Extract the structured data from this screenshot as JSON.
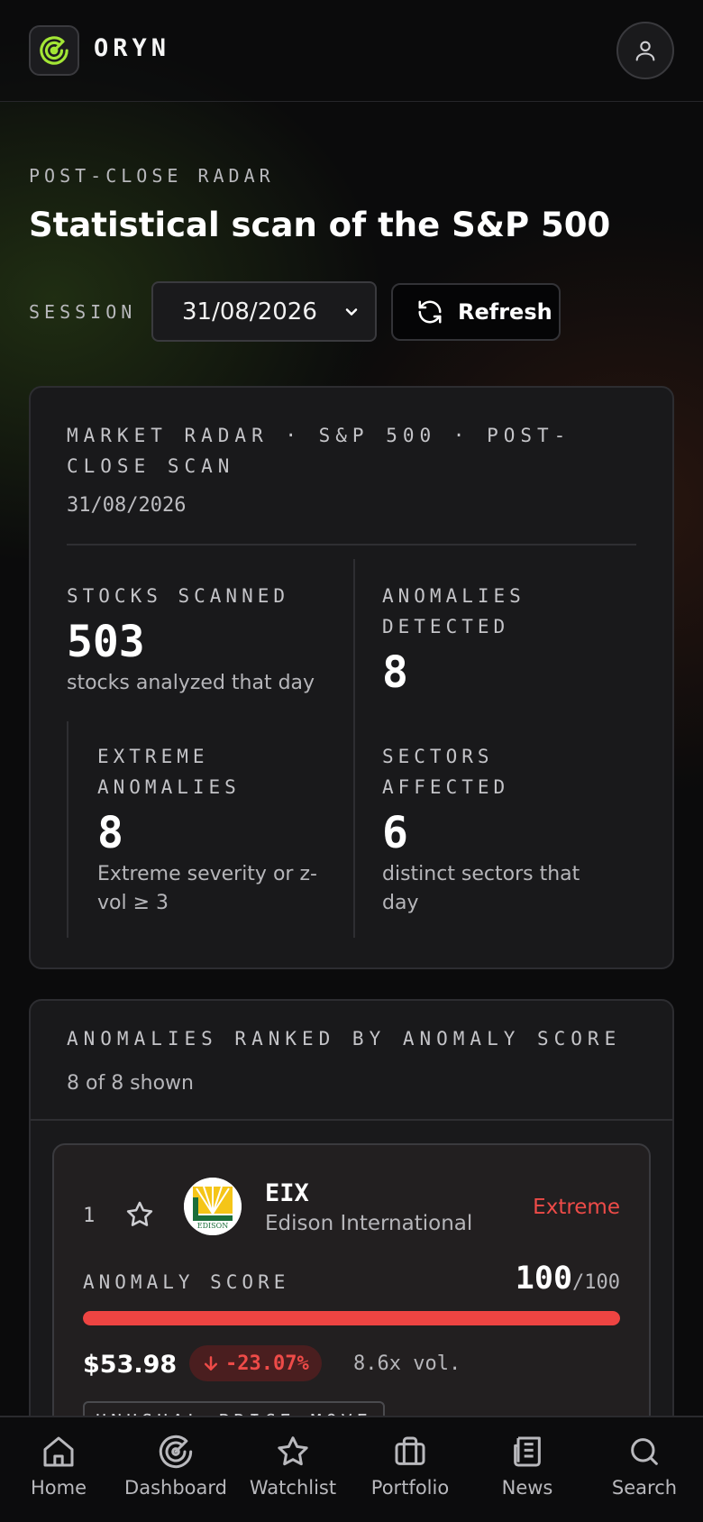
{
  "app": {
    "brand": "ORYN"
  },
  "hero": {
    "eyebrow": "POST-CLOSE RADAR",
    "title": "Statistical scan of the S&P 500",
    "session_label": "SESSION",
    "session_value": "31/08/2026",
    "refresh_label": "Refresh"
  },
  "summary": {
    "heading": "MARKET RADAR · S&P 500 · POST-CLOSE SCAN",
    "date": "31/08/2026",
    "stats": [
      {
        "label": "STOCKS SCANNED",
        "value": "503",
        "desc": "stocks analyzed that day"
      },
      {
        "label": "ANOMALIES DETECTED",
        "value": "8",
        "desc": ""
      },
      {
        "label": "EXTREME ANOMALIES",
        "value": "8",
        "desc": "Extreme severity or z-vol ≥ 3"
      },
      {
        "label": "SECTORS AFFECTED",
        "value": "6",
        "desc": "distinct sectors that day"
      }
    ]
  },
  "ranked": {
    "heading": "ANOMALIES RANKED BY ANOMALY SCORE",
    "count": "8 of 8 shown",
    "items": [
      {
        "rank": "1",
        "ticker": "EIX",
        "company": "Edison International",
        "logo_text": "EDISON",
        "severity": "Extreme",
        "score_label": "ANOMALY SCORE",
        "score": "100",
        "score_max": "/100",
        "score_fraction": 1.0,
        "price": "$53.98",
        "change": "-23.07%",
        "volume": "8.6x vol.",
        "tag": "UNUSUAL PRICE MOVE"
      }
    ]
  },
  "nav": [
    {
      "label": "Home",
      "icon": "home-icon"
    },
    {
      "label": "Dashboard",
      "icon": "radar-icon"
    },
    {
      "label": "Watchlist",
      "icon": "star-icon"
    },
    {
      "label": "Portfolio",
      "icon": "briefcase-icon"
    },
    {
      "label": "News",
      "icon": "newspaper-icon"
    },
    {
      "label": "Search",
      "icon": "search-icon"
    }
  ],
  "colors": {
    "accent": "#a3e635",
    "danger": "#ee4b48",
    "background": "#0b0b0c"
  }
}
